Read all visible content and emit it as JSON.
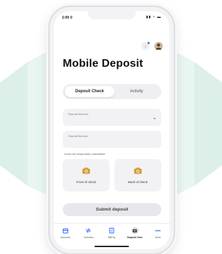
{
  "status": {
    "time": "2:09 ⚲",
    "icons": "▮▮ ≈ ▬"
  },
  "header": {
    "title": "Mobile Deposit"
  },
  "tabs": [
    {
      "label": "Deposit Check",
      "active": true
    },
    {
      "label": "Activity",
      "active": false
    }
  ],
  "form": {
    "account_label": "Deposit Account",
    "amount_label": "Deposit Amount",
    "limit_note": "Limits are temporarily unavailable"
  },
  "capture": {
    "front_label": "Front of check",
    "back_label": "Back of check"
  },
  "submit_label": "Submit deposit",
  "nav": [
    {
      "label": "Accounts",
      "icon": "accounts-icon"
    },
    {
      "label": "Transfers",
      "icon": "transfers-icon"
    },
    {
      "label": "BillPay",
      "icon": "billpay-icon"
    },
    {
      "label": "Deposit Chec",
      "icon": "deposit-check-icon",
      "active": true
    },
    {
      "label": "More",
      "icon": "more-icon"
    }
  ],
  "colors": {
    "accent": "#2f6bff",
    "camera_icon": "#d69a3a",
    "background_shape": "#dcefe9"
  }
}
